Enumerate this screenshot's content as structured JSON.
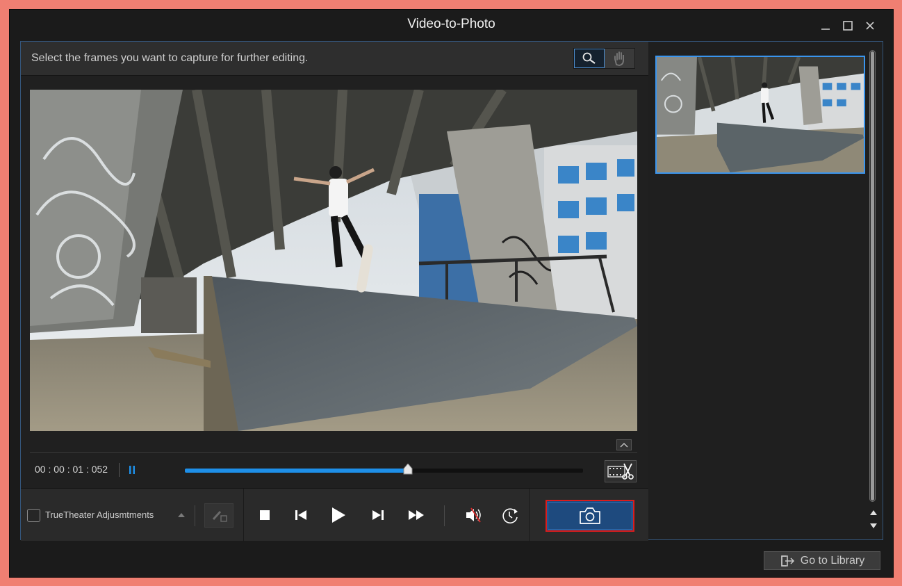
{
  "window": {
    "title": "Video-to-Photo"
  },
  "instructions": {
    "text": "Select the frames you want to capture for further editing."
  },
  "tools": {
    "zoom_icon": "magnifier-icon",
    "pan_icon": "hand-icon"
  },
  "player": {
    "timecode": "00 : 00 : 01 : 052",
    "progress": 0.56,
    "accent_color": "#1e8fe8"
  },
  "controls": {
    "truetheater_label": "TrueTheater Adjusmtments",
    "truetheater_checked": false
  },
  "capture": {
    "highlight_color": "#dc1c1c",
    "button_color": "#1e4a7e"
  },
  "footer": {
    "library_label": "Go to Library"
  }
}
